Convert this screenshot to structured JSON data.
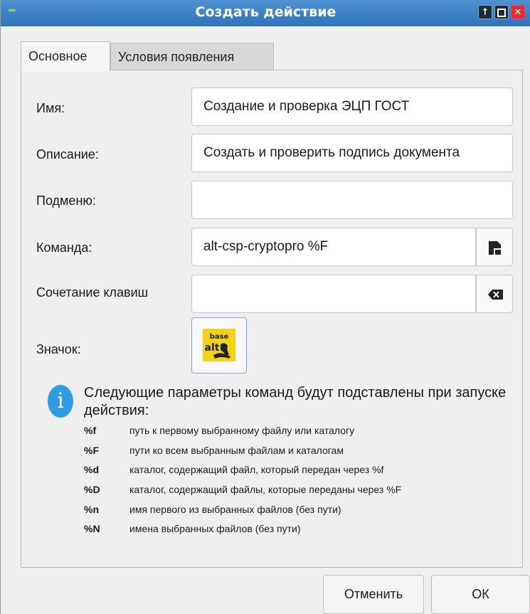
{
  "window": {
    "title": "Создать действие",
    "controls": [
      "up-arrow-icon",
      "maximize-icon",
      "close-icon"
    ]
  },
  "tabs": [
    {
      "label": "Основное",
      "active": true
    },
    {
      "label": "Условия появления",
      "active": false
    }
  ],
  "form": {
    "name_label": "Имя:",
    "name_value": "Создание и проверка ЭЦП ГОСТ",
    "description_label": "Описание:",
    "description_value": "Создать и проверить подпись документа",
    "submenu_label": "Подменю:",
    "submenu_value": "",
    "command_label": "Команда:",
    "command_value": "alt-csp-cryptopro %F",
    "shortcut_label": "Сочетание клавиш",
    "shortcut_value": "",
    "icon_label": "Значок:",
    "icon_name": "basealt-logo-icon",
    "icon_logo_top": "base",
    "icon_logo_bottom": "alt"
  },
  "info": {
    "heading": "Следующие параметры команд будут подставлены при запуске действия:",
    "params": [
      {
        "key": "%f",
        "desc": "путь к первому выбранному файлу или каталогу"
      },
      {
        "key": "%F",
        "desc": "пути ко всем выбранным файлам и каталогам"
      },
      {
        "key": "%d",
        "desc": "каталог, содержащий файл, который передан через %f"
      },
      {
        "key": "%D",
        "desc": "каталог, содержащий файлы, которые переданы через %F"
      },
      {
        "key": "%n",
        "desc": "имя первого из выбранных файлов (без пути)"
      },
      {
        "key": "%N",
        "desc": "имена выбранных файлов (без пути)"
      }
    ]
  },
  "buttons": {
    "cancel": "Отменить",
    "ok": "ОК"
  },
  "colors": {
    "titlebar": "#3d82c8",
    "close": "#d8322b",
    "info": "#2f9be0"
  }
}
